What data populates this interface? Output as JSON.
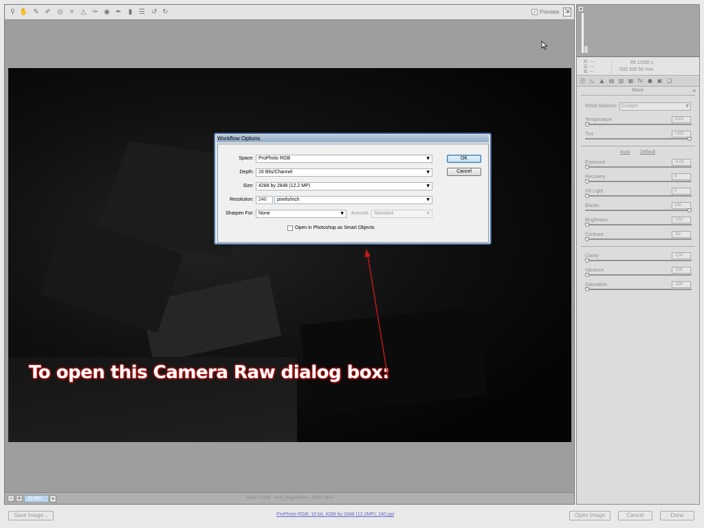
{
  "toolbar": {
    "tools": [
      {
        "name": "zoom-tool-icon",
        "glyph": "⚲"
      },
      {
        "name": "hand-tool-icon",
        "glyph": "✋"
      },
      {
        "name": "white-balance-tool-icon",
        "glyph": "✎"
      },
      {
        "name": "color-sampler-tool-icon",
        "glyph": "✐"
      },
      {
        "name": "targeted-adjustment-tool-icon",
        "glyph": "◎"
      },
      {
        "name": "crop-tool-icon",
        "glyph": "⌗"
      },
      {
        "name": "straighten-tool-icon",
        "glyph": "△"
      },
      {
        "name": "spot-removal-tool-icon",
        "glyph": "✑"
      },
      {
        "name": "red-eye-removal-tool-icon",
        "glyph": "◉"
      },
      {
        "name": "adjustment-brush-tool-icon",
        "glyph": "✒"
      },
      {
        "name": "graduated-filter-tool-icon",
        "glyph": "▮"
      },
      {
        "name": "preferences-icon",
        "glyph": "☰"
      },
      {
        "name": "rotate-left-icon",
        "glyph": "↺"
      },
      {
        "name": "rotate-right-icon",
        "glyph": "↻"
      }
    ],
    "preview_label": "Preview",
    "preview_checked": "✓"
  },
  "caption": "To open this Camera Raw dialog box:",
  "status_bar": {
    "zoom_out": "-",
    "zoom_in": "+",
    "zoom_level": "29.8%",
    "zoom_arrow": "▾",
    "filename": "Nikon D300  -  test_BagPhotos_0005.NEF"
  },
  "info_panel": {
    "r_label": "R:  ---",
    "g_label": "G:  ---",
    "b_label": "B:  ---",
    "aperture_shutter": "f/8    1/250 s",
    "iso_focal": "ISO 200    50 mm"
  },
  "panel": {
    "title": "Basic",
    "menu_glyph": "≡",
    "tabs": [
      "◍",
      "◺",
      "▲",
      "▤",
      "▥",
      "▦",
      "fx",
      "●",
      "▣",
      "❑"
    ],
    "white_balance_label": "White Balance:",
    "white_balance_value": "Custom",
    "auto_link": "Auto",
    "default_link": "Default",
    "sliders": [
      {
        "key": "temperature",
        "label": "Temperature",
        "value": "2000",
        "pos": 0
      },
      {
        "key": "tint",
        "label": "Tint",
        "value": "+150",
        "pos": 100
      },
      {
        "key": "exposure",
        "label": "Exposure",
        "value": "-4.00",
        "pos": 0
      },
      {
        "key": "recovery",
        "label": "Recovery",
        "value": "0",
        "pos": 0
      },
      {
        "key": "fill-light",
        "label": "Fill Light",
        "value": "0",
        "pos": 0
      },
      {
        "key": "blacks",
        "label": "Blacks",
        "value": "100",
        "pos": 100
      },
      {
        "key": "brightness",
        "label": "Brightness",
        "value": "-150",
        "pos": 0
      },
      {
        "key": "contrast",
        "label": "Contrast",
        "value": "-50",
        "pos": 0
      },
      {
        "key": "clarity",
        "label": "Clarity",
        "value": "-100",
        "pos": 0
      },
      {
        "key": "vibrance",
        "label": "Vibrance",
        "value": "-100",
        "pos": 0
      },
      {
        "key": "saturation",
        "label": "Saturation",
        "value": "-100",
        "pos": 0
      }
    ]
  },
  "bottom_bar": {
    "save_label": "Save Image...",
    "workflow_link": "ProPhoto RGB; 16 bit; 4288 by 2848 (12.2MP); 240 ppi",
    "open_label": "Open Image",
    "cancel_label": "Cancel",
    "done_label": "Done"
  },
  "dialog": {
    "title": "Workflow Options",
    "space_label": "Space:",
    "space_value": "ProPhoto RGB",
    "depth_label": "Depth:",
    "depth_value": "16 Bits/Channel",
    "size_label": "Size:",
    "size_value": "4288 by 2848  (12.2 MP)",
    "resolution_label": "Resolution:",
    "resolution_value": "240",
    "resolution_unit": "pixels/inch",
    "sharpen_label": "Sharpen For:",
    "sharpen_value": "None",
    "amount_label": "Amount:",
    "amount_value": "Standard",
    "smart_objects_label": "Open in Photoshop as Smart Objects",
    "ok_label": "OK",
    "cancel_label": "Cancel",
    "dropdown_arrow": "▼"
  },
  "colors": {
    "annotation_red": "#c0181b",
    "dialog_border": "#4a6fa0",
    "workflow_link": "#6666cc"
  }
}
